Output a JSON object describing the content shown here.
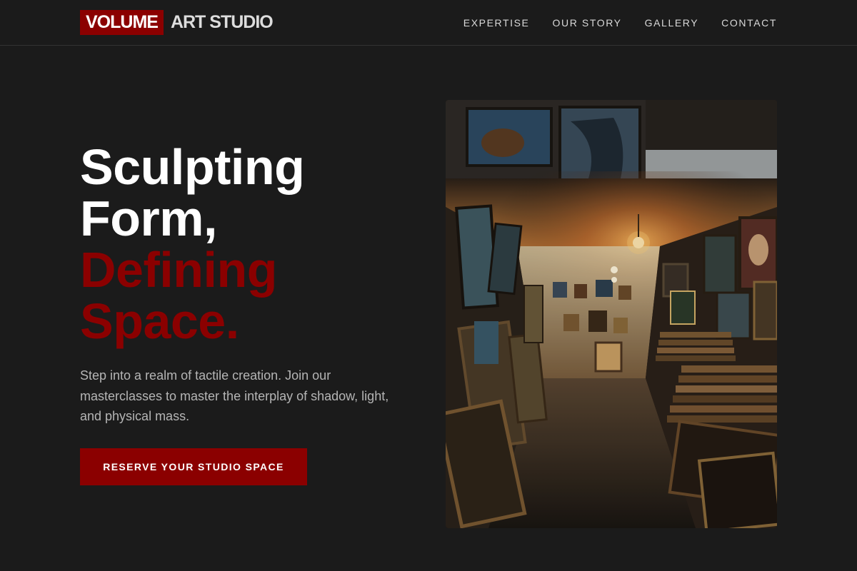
{
  "header": {
    "logo_badge": "VOLUME",
    "logo_text": "ART STUDIO",
    "nav": [
      "EXPERTISE",
      "OUR STORY",
      "GALLERY",
      "CONTACT"
    ]
  },
  "hero": {
    "title_lines": [
      "Sculpting",
      "Form,"
    ],
    "accent_lines": [
      "Defining",
      "Space."
    ],
    "description": "Step into a realm of tactile creation. Join our masterclasses to master the interplay of shadow, light, and physical mass.",
    "cta_label": "RESERVE YOUR STUDIO SPACE"
  },
  "colors": {
    "background": "#1b1b1b",
    "accent": "#8b0000",
    "text_primary": "#ffffff",
    "text_muted": "#b5b5b5"
  }
}
